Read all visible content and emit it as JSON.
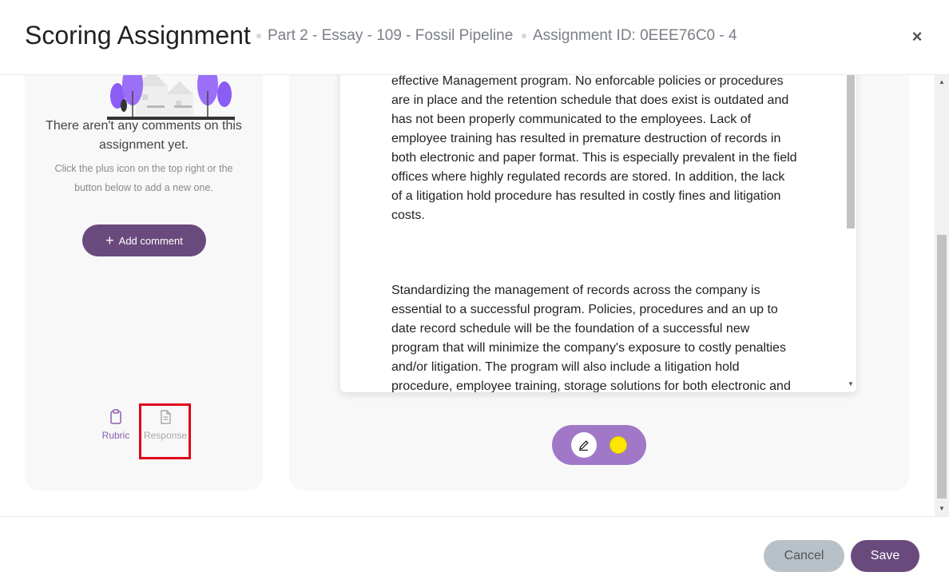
{
  "header": {
    "title": "Scoring Assignment",
    "crumb_part": "Part 2 - Essay - 109 - Fossil Pipeline",
    "crumb_id": "Assignment ID: 0EEE76C0 - 4",
    "close_glyph": "×"
  },
  "comments": {
    "empty_title": "There aren't any comments on this assignment yet.",
    "empty_sub": "Click the plus icon on the top right or the button below to add a new one.",
    "add_label": "Add comment",
    "add_icon": "+"
  },
  "tabs": {
    "rubric_label": "Rubric",
    "response_label": "Response"
  },
  "document": {
    "paragraph_1": "effective Management program. No enforcable policies or procedures are in place and the retention schedule that does exist is outdated and has not been properly communicated to the employees. Lack of employee training has resulted in premature destruction of records in both electronic and paper format. This is especially prevalent in the field offices where highly regulated records are stored. In addition, the lack of a litigation hold procedure has resulted in costly fines and litigation costs.",
    "paragraph_2": "Standardizing the management of records across the company is essential to a successful program. Policies, procedures and an up to date record schedule will be the foundation of a successful new program that will minimize the company's exposure to costly penalties and/or litigation. The program will also include a litigation hold procedure, employee training, storage solutions for both electronic and"
  },
  "toolbar": {
    "pen_icon": "pencil-icon",
    "highlight_color": "#ffe600"
  },
  "footer": {
    "cancel_label": "Cancel",
    "save_label": "Save"
  },
  "colors": {
    "brand": "#6a4a7c",
    "accent": "#a178c8",
    "highlight_box": "#e0001b"
  }
}
